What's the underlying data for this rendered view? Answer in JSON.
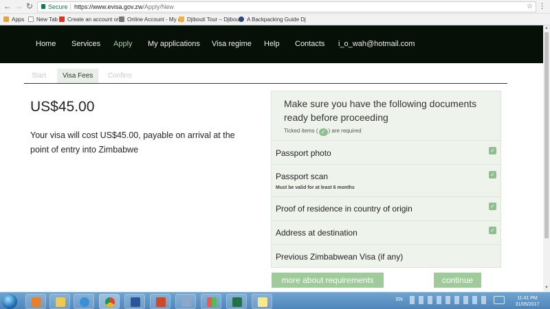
{
  "browser": {
    "secure_label": "Secure",
    "url_host": "https://www.evisa.gov.zw",
    "url_path": "/Apply/New",
    "bookmarks": [
      {
        "label": "Apps",
        "color": "#e8a33d"
      },
      {
        "label": "New Tab",
        "color": "#ffffff"
      },
      {
        "label": "Create an account or si",
        "color": "#d9362b"
      },
      {
        "label": "Online Account - My ap",
        "color": "#777777"
      },
      {
        "label": "Djibouti Tour – Djibouti",
        "color": "#f0b23a"
      },
      {
        "label": "A Backpacking Guide Dj",
        "color": "#2d4a7a"
      }
    ]
  },
  "nav": {
    "items": [
      {
        "label": "Home"
      },
      {
        "label": "Services"
      },
      {
        "label": "Apply"
      },
      {
        "label": "My applications"
      },
      {
        "label": "Visa regime"
      },
      {
        "label": "Help"
      },
      {
        "label": "Contacts"
      },
      {
        "label": "i_o_wah@hotmail.com"
      }
    ],
    "active_index": 2,
    "active_color": "#9ed39e"
  },
  "steps": {
    "items": [
      {
        "label": "Start"
      },
      {
        "label": "Visa Fees"
      },
      {
        "label": "Confirm"
      }
    ],
    "active_index": 1
  },
  "fee": {
    "price": "US$45.00",
    "description": "Your visa will cost US$45.00, payable on arrival at the point of entry into Zimbabwe"
  },
  "requirements": {
    "heading": "Make sure you have the following documents ready before proceeding",
    "note_before": "Ticked items (",
    "note_after": ") are required",
    "tick_glyph": "✓",
    "items": [
      {
        "label": "Passport photo",
        "sub": "",
        "required": true
      },
      {
        "label": "Passport scan",
        "sub": "Must be valid for at least 6 months",
        "required": true
      },
      {
        "label": "Proof of residence in country of origin",
        "sub": "",
        "required": true
      },
      {
        "label": "Address at destination",
        "sub": "",
        "required": true
      },
      {
        "label": "Previous Zimbabwean Visa (if any)",
        "sub": "",
        "required": false
      }
    ],
    "more_button": "more about requirements",
    "continue_button": "continue",
    "accent": "#9fcb9a"
  },
  "taskbar": {
    "language": "EN",
    "time": "11:41 PM",
    "date": "31/05/2017"
  }
}
